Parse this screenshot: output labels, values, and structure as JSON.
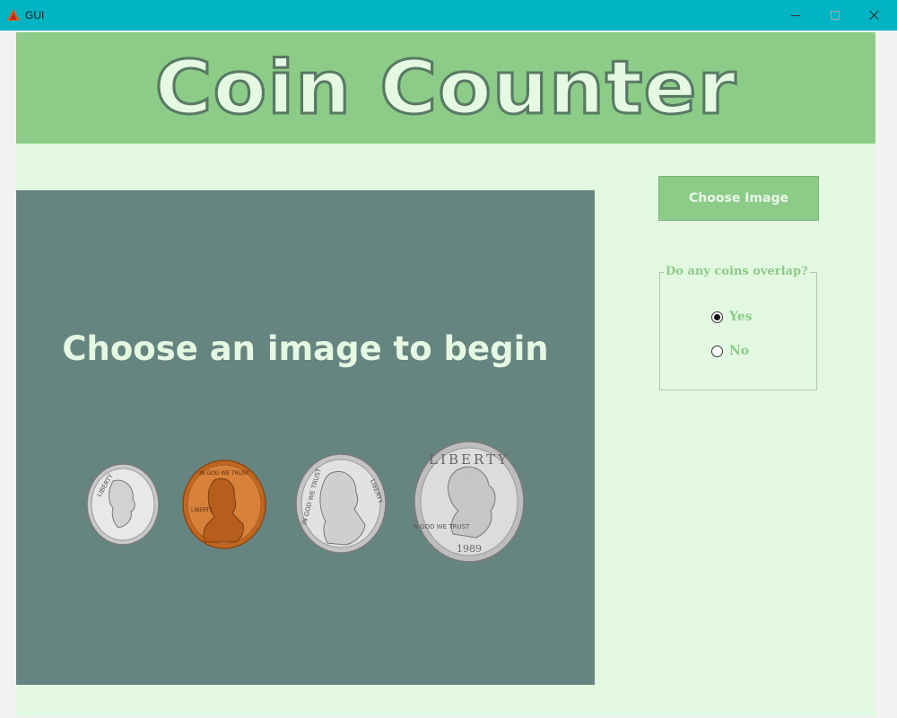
{
  "window": {
    "title": "GUI",
    "controls": [
      "minimize",
      "maximize",
      "close"
    ]
  },
  "header": {
    "title": "Coin Counter"
  },
  "image_panel": {
    "prompt": "Choose an image to begin",
    "coins": [
      {
        "name": "dime",
        "legend": "LIBERTY",
        "color": "#d8d8d8"
      },
      {
        "name": "penny",
        "legend": "LIBERTY",
        "motto": "IN GOD WE TRUST",
        "color": "#d07a3a"
      },
      {
        "name": "nickel",
        "legend": "LIBERTY",
        "motto": "IN GOD WE TRUST",
        "color": "#d4d4d4"
      },
      {
        "name": "quarter",
        "legend": "LIBERTY",
        "motto": "IN GOD WE TRUST",
        "year": "1989",
        "color": "#d0d0d0"
      }
    ]
  },
  "controls": {
    "choose_button_label": "Choose Image",
    "overlap_group": {
      "legend": "Do any coins overlap?",
      "options": [
        {
          "label": "Yes",
          "checked": true
        },
        {
          "label": "No",
          "checked": false
        }
      ]
    }
  },
  "colors": {
    "titlebar": "#00b4c4",
    "background": "#e2f8e0",
    "accent": "#8ccb88",
    "panel": "#668580",
    "text_light": "#e4f8e2"
  }
}
